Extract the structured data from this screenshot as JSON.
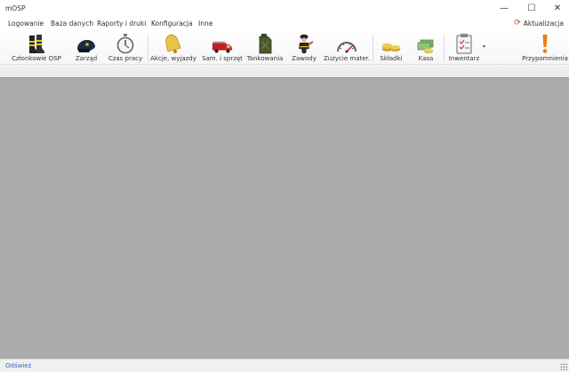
{
  "window": {
    "title": "mOSP",
    "minimize_glyph": "—",
    "maximize_glyph": "☐",
    "close_glyph": "✕"
  },
  "menu": {
    "items": [
      "Logowanie",
      "Baza danych",
      "Raporty i druki",
      "Konfiguracja",
      "Inne"
    ],
    "update_label": "Aktualizacja",
    "update_icon": "refresh-icon"
  },
  "toolbar": {
    "items": [
      {
        "label": "Członkowie OSP",
        "icon": "boots-icon"
      },
      {
        "label": "Zarząd",
        "icon": "cap-icon"
      },
      {
        "label": "Czas pracy",
        "icon": "stopwatch-icon"
      },
      {
        "label": "Akcje, wyjazdy",
        "icon": "bell-icon"
      },
      {
        "label": "Sam. i sprzęt",
        "icon": "fire-truck-icon"
      },
      {
        "label": "Tankowania",
        "icon": "jerrycan-icon"
      },
      {
        "label": "Zawody",
        "icon": "firefighter-icon"
      },
      {
        "label": "Zużycie mater.",
        "icon": "gauge-icon"
      },
      {
        "label": "Składki",
        "icon": "coins-icon"
      },
      {
        "label": "Kasa",
        "icon": "cash-icon"
      },
      {
        "label": "Inwentarz",
        "icon": "clipboard-icon"
      },
      {
        "label": "Przypomnienia",
        "icon": "exclamation-icon"
      }
    ],
    "dropdown_glyph": "▾"
  },
  "status": {
    "refresh_label": "Odśwież"
  },
  "colors": {
    "workspace": "#ababab",
    "link": "#3b5fc6",
    "alert": "#f07a10"
  }
}
